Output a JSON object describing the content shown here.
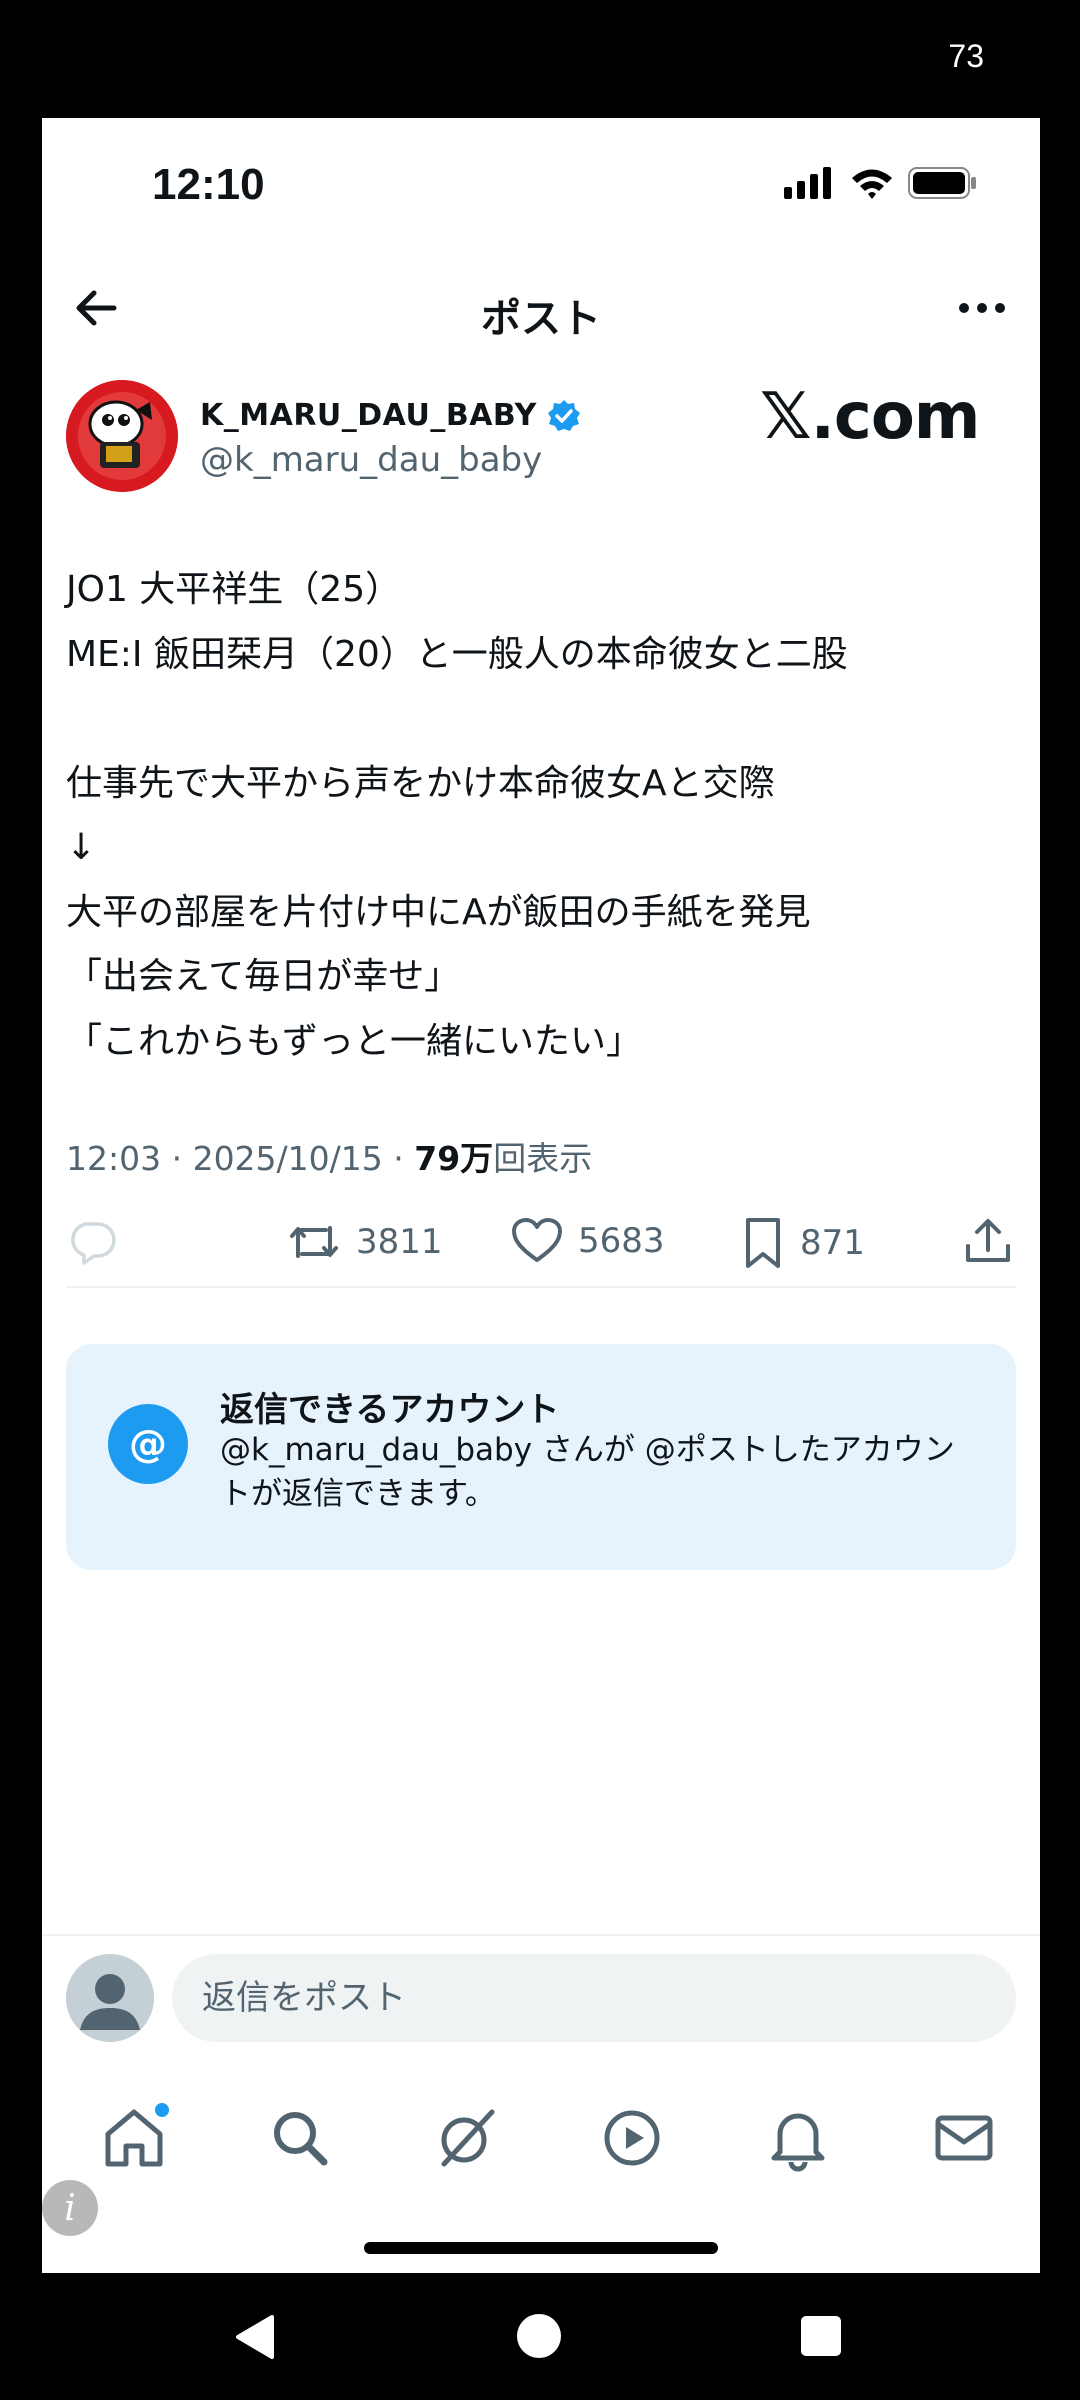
{
  "device": {
    "battery_level": "73"
  },
  "status_bar": {
    "time": "12:10"
  },
  "header": {
    "title": "ポスト"
  },
  "post": {
    "display_name": "K_MARU_DAU_BABY",
    "handle": "@k_maru_dau_baby",
    "watermark": "𝕏.com",
    "body": "JO1 大平祥生（25）\nME:I 飯田栞月（20）と一般人の本命彼女と二股\n\n仕事先で大平から声をかけ本命彼女Aと交際\n↓\n大平の部屋を片付け中にAが飯田の手紙を発見\n「出会えて毎日が幸せ」\n「これからもずっと一緒にいたい」",
    "time_date": "12:03 · 2025/10/15 · ",
    "views_count": "79万",
    "views_label": "回表示",
    "retweets": "3811",
    "likes": "5683",
    "bookmarks": "871"
  },
  "reply_notice": {
    "icon": "@",
    "title": "返信できるアカウント",
    "text": "@k_maru_dau_baby さんが @ポストしたアカウントが返信できます。"
  },
  "composer": {
    "placeholder": "返信をポスト"
  },
  "colors": {
    "accent": "#1d9bf0",
    "text": "#0f1419",
    "muted": "#536471",
    "card_bg": "#e6f3fc"
  },
  "icons": [
    "back-arrow-icon",
    "more-icon",
    "verified-badge-icon",
    "reply-icon",
    "retweet-icon",
    "like-icon",
    "bookmark-icon",
    "share-icon",
    "home-icon",
    "search-icon",
    "grok-icon",
    "video-icon",
    "notifications-icon",
    "messages-icon",
    "info-icon",
    "nav-back-icon",
    "nav-home-icon",
    "nav-recents-icon"
  ]
}
